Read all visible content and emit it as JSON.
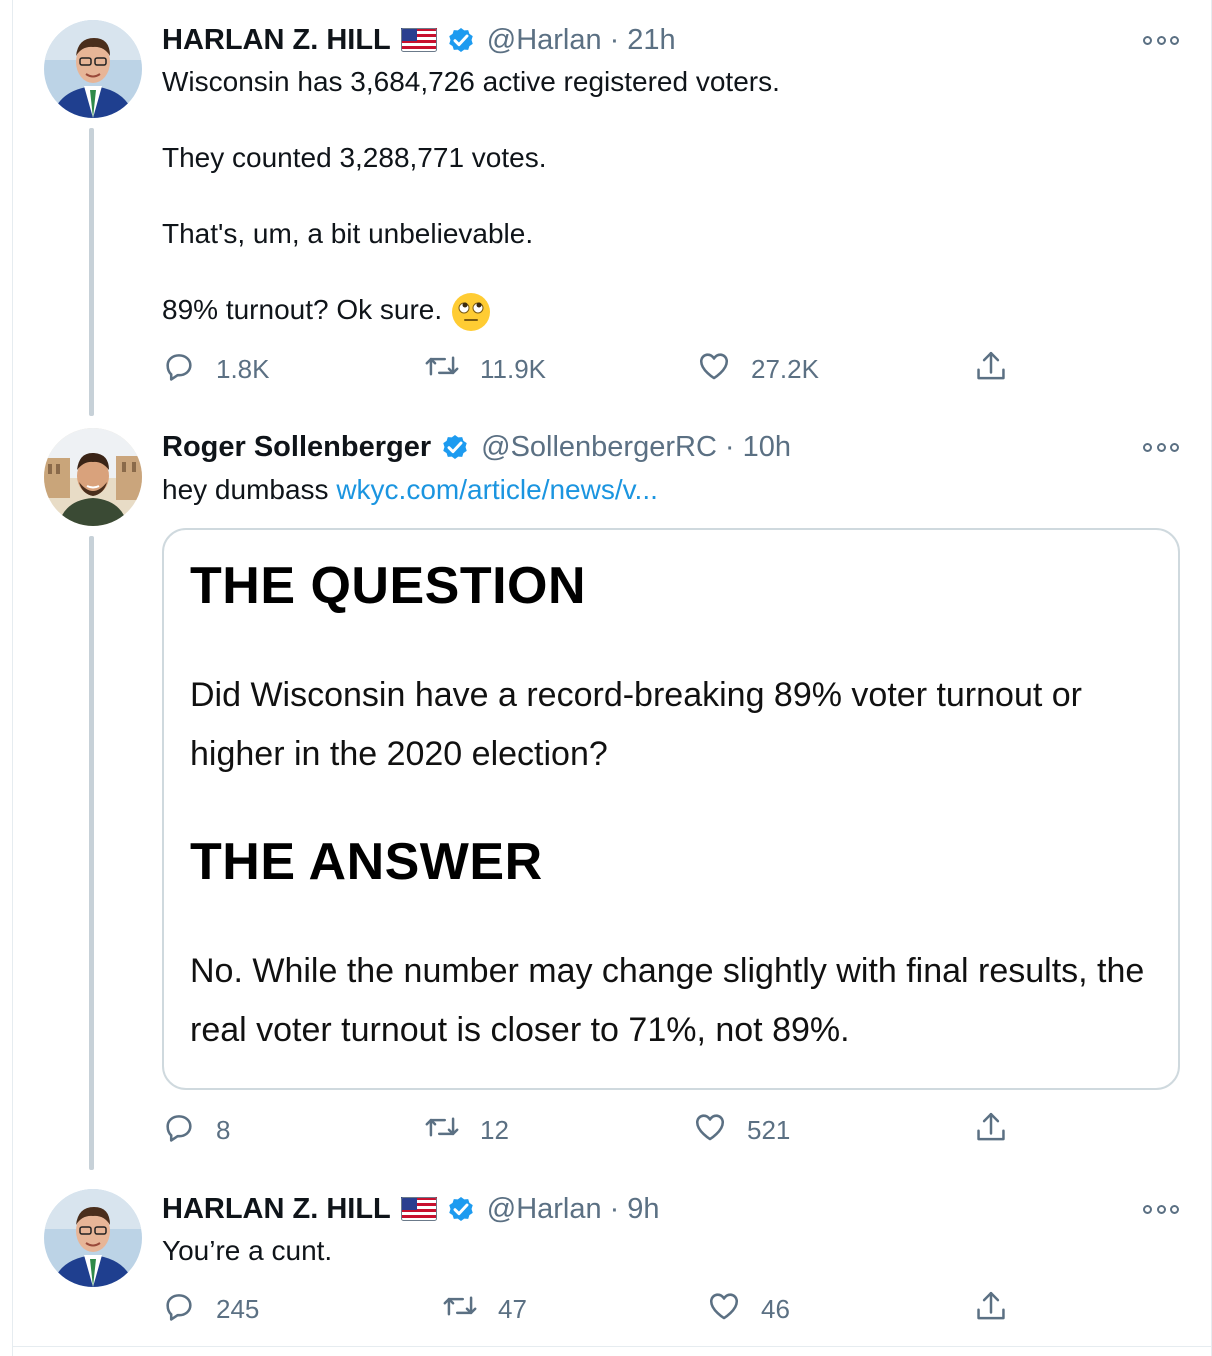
{
  "tweets": [
    {
      "name": "HARLAN Z. HILL",
      "handle": "@Harlan",
      "time": "21h",
      "lines": [
        "Wisconsin has 3,684,726 active registered voters.",
        "They counted 3,288,771 votes.",
        "That's, um, a bit unbelievable.",
        "89% turnout? Ok sure."
      ],
      "emoji": "face-with-rolling-eyes-icon",
      "replies": "1.8K",
      "retweets": "11.9K",
      "likes": "27.2K"
    },
    {
      "name": "Roger Sollenberger",
      "handle": "@SollenbergerRC",
      "time": "10h",
      "text": "hey dumbass",
      "link": "wkyc.com/article/news/v...",
      "card": {
        "question_title": "THE QUESTION",
        "question": "Did Wisconsin have a record-breaking 89% voter turnout or higher in the 2020 election?",
        "answer_title": "THE ANSWER",
        "answer": "No. While the number may change slightly with final results, the real voter turnout is closer to 71%, not 89%."
      },
      "replies": "8",
      "retweets": "12",
      "likes": "521"
    },
    {
      "name": "HARLAN Z. HILL",
      "handle": "@Harlan",
      "time": "9h",
      "text": "You’re a cunt.",
      "replies": "245",
      "retweets": "47",
      "likes": "46"
    }
  ],
  "separator": "·",
  "colors": {
    "link": "#1b95e0",
    "verified": "#1d9bf0",
    "muted": "#5b7083",
    "thread_line": "#c7d1d8"
  }
}
